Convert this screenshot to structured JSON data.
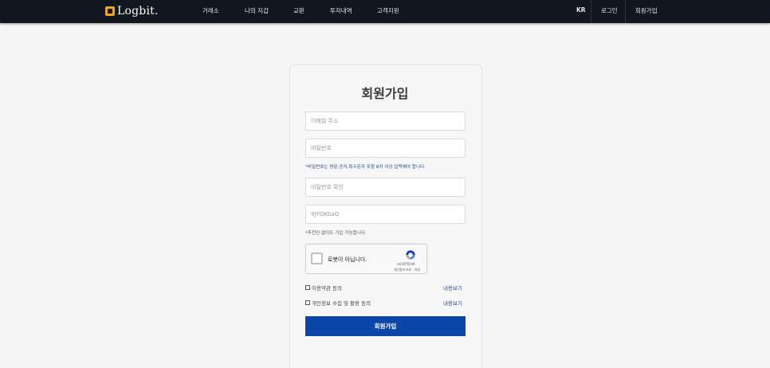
{
  "header": {
    "brand": "Logbit.",
    "nav": [
      "거래소",
      "나의 지갑",
      "교환",
      "투자내역",
      "고객지원"
    ],
    "lang": "KR",
    "login": "로그인",
    "signup": "회원가입"
  },
  "form": {
    "title": "회원가입",
    "email_placeholder": "이메일 주소",
    "password_placeholder": "비밀번호",
    "password_hint": "*비밀번호는 영문,숫자,특수문자 포함 8자 이상 입력해야 합니다.",
    "password_confirm_placeholder": "비밀번호 확인",
    "referral_value": "9JYQKbaQ",
    "referral_hint": "*추천인 없이도 가입 가능합니다.",
    "recaptcha": {
      "label": "로봇이 아닙니다.",
      "brand": "reCAPTCHA",
      "links": "개인정보 보호 - 약관"
    },
    "agreements": [
      {
        "label": "이용약관 동의",
        "link": "내용보기"
      },
      {
        "label": "개인정보 수집 및 활용 동의",
        "link": "내용보기"
      }
    ],
    "submit_label": "회원가입"
  },
  "colors": {
    "header_bg": "#12161f",
    "accent": "#0b46a9",
    "logo": "#f0a51c"
  }
}
